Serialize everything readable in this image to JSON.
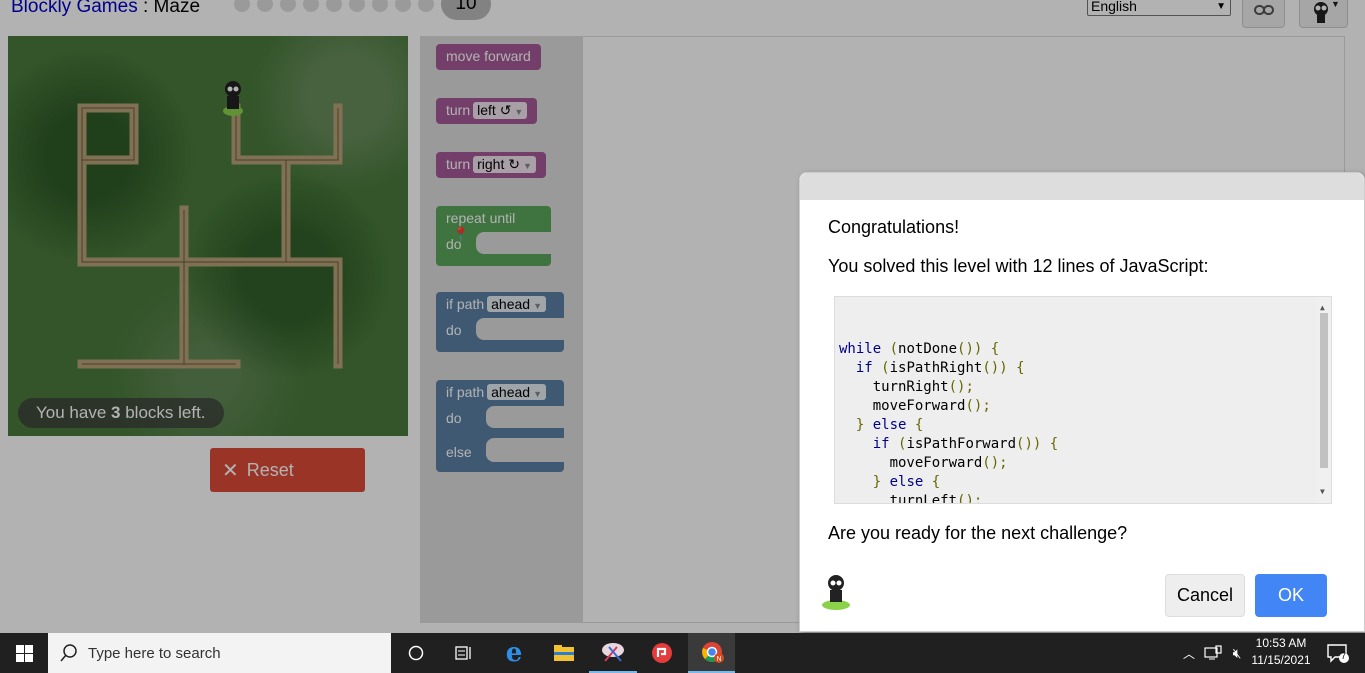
{
  "header": {
    "site": "Blockly Games",
    "separator": " : ",
    "game": "Maze",
    "current_level": "10",
    "language": "English"
  },
  "maze": {
    "blocks_left_prefix": "You have ",
    "blocks_left_count": "3",
    "blocks_left_suffix": " blocks left.",
    "reset_label": "Reset",
    "reset_icon": "close-x-icon"
  },
  "toolbox": {
    "move_forward": "move forward",
    "turn": "turn",
    "left_option": "left ↺",
    "right_option": "right ↻",
    "repeat_until": "repeat until",
    "do": "do",
    "if_path": "if path",
    "ahead_option": "ahead",
    "else": "else"
  },
  "dialog": {
    "title": "Congratulations!",
    "message": "You solved this level with 12 lines of JavaScript:",
    "code_lines": [
      "while (notDone()) {",
      "  if (isPathRight()) {",
      "    turnRight();",
      "    moveForward();",
      "  } else {",
      "    if (isPathForward()) {",
      "      moveForward();",
      "    } else {",
      "      turnLeft();",
      "    }",
      "  }"
    ],
    "question": "Are you ready for the next challenge?",
    "cancel_label": "Cancel",
    "ok_label": "OK"
  },
  "taskbar": {
    "search_placeholder": "Type here to search",
    "time": "10:53 AM",
    "date": "11/15/2021",
    "notification_count": "7"
  },
  "colors": {
    "ok_button": "#4285f4",
    "reset_button": "#dd4b39",
    "block_purple": "#a55b99",
    "block_green": "#5ba55b",
    "block_blue": "#5b80a5"
  }
}
